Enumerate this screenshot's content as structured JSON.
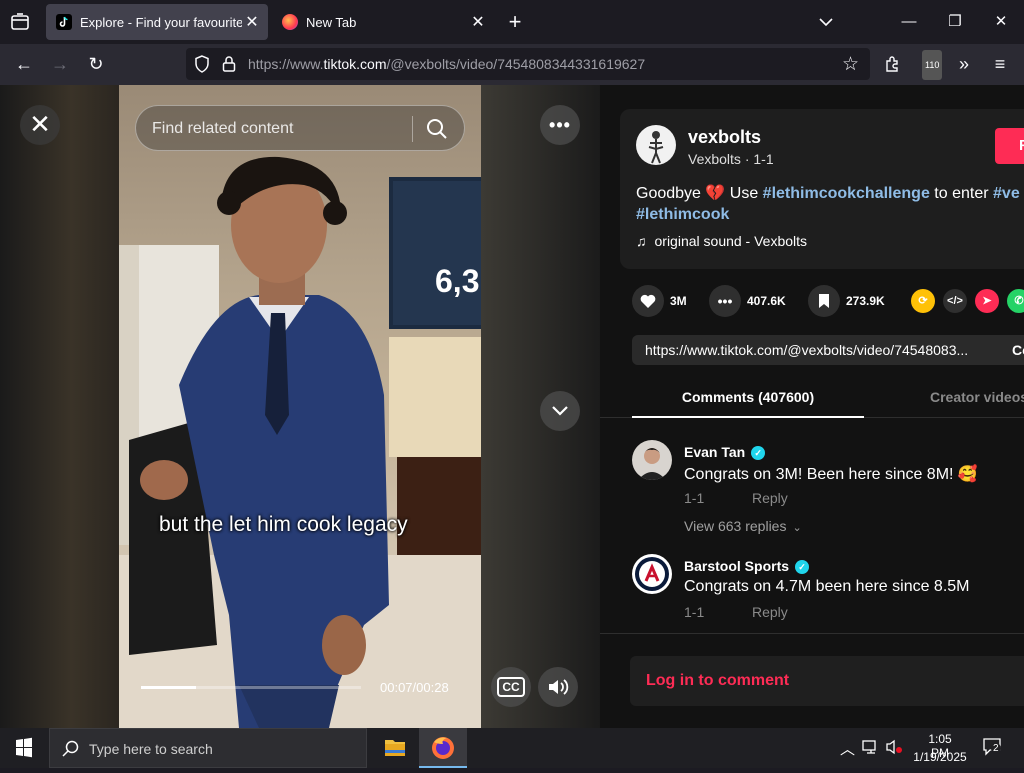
{
  "browser": {
    "tabs": [
      {
        "title": "Explore - Find your favourite vid",
        "active": true
      },
      {
        "title": "New Tab",
        "active": false
      }
    ],
    "url_prefix": "https://www.",
    "url_domain": "tiktok.com",
    "url_path": "/@vexbolts/video/7454808344331619627",
    "extension_badge": "110"
  },
  "video": {
    "search_placeholder": "Find related content",
    "caption": "but the let him cook legacy",
    "current_time": "00:07",
    "duration": "00:28",
    "time_display": "00:07/00:28",
    "progress": 0.25,
    "overlay_text": "6,3"
  },
  "post": {
    "username": "vexbolts",
    "nickname": "Vexbolts · 1-1",
    "follow_label": "F",
    "desc_prefix": "Goodbye",
    "desc_emoji": "💔",
    "desc_use": "Use",
    "hashtag1": "#lethimcookchallenge",
    "desc_mid": "to enter",
    "hashtag_cut": "#ve",
    "hashtag2": "#lethimcook",
    "music": "original sound - Vexbolts",
    "likes": "3M",
    "comments": "407.6K",
    "saves": "273.9K",
    "share_link": "https://www.tiktok.com/@vexbolts/video/74548083...",
    "copy_label": "Co"
  },
  "tabs": {
    "comments": "Comments (407600)",
    "creator": "Creator videos"
  },
  "comments": [
    {
      "name": "Evan Tan",
      "text": "Congrats on 3M! Been here since 8M! 🥰",
      "date": "1-1",
      "reply": "Reply",
      "view_replies": "View 663 replies"
    },
    {
      "name": "Barstool Sports",
      "text": "Congrats on 4.7M been here since 8.5M",
      "date": "1-1",
      "reply": "Reply"
    }
  ],
  "login_label": "Log in to comment",
  "taskbar": {
    "search_placeholder": "Type here to search",
    "time": "1:05 PM",
    "date": "1/19/2025",
    "notification_count": "2"
  },
  "colors": {
    "accent": "#fe2c55",
    "hashtag": "#8fbce6",
    "verified": "#20d5ec"
  }
}
